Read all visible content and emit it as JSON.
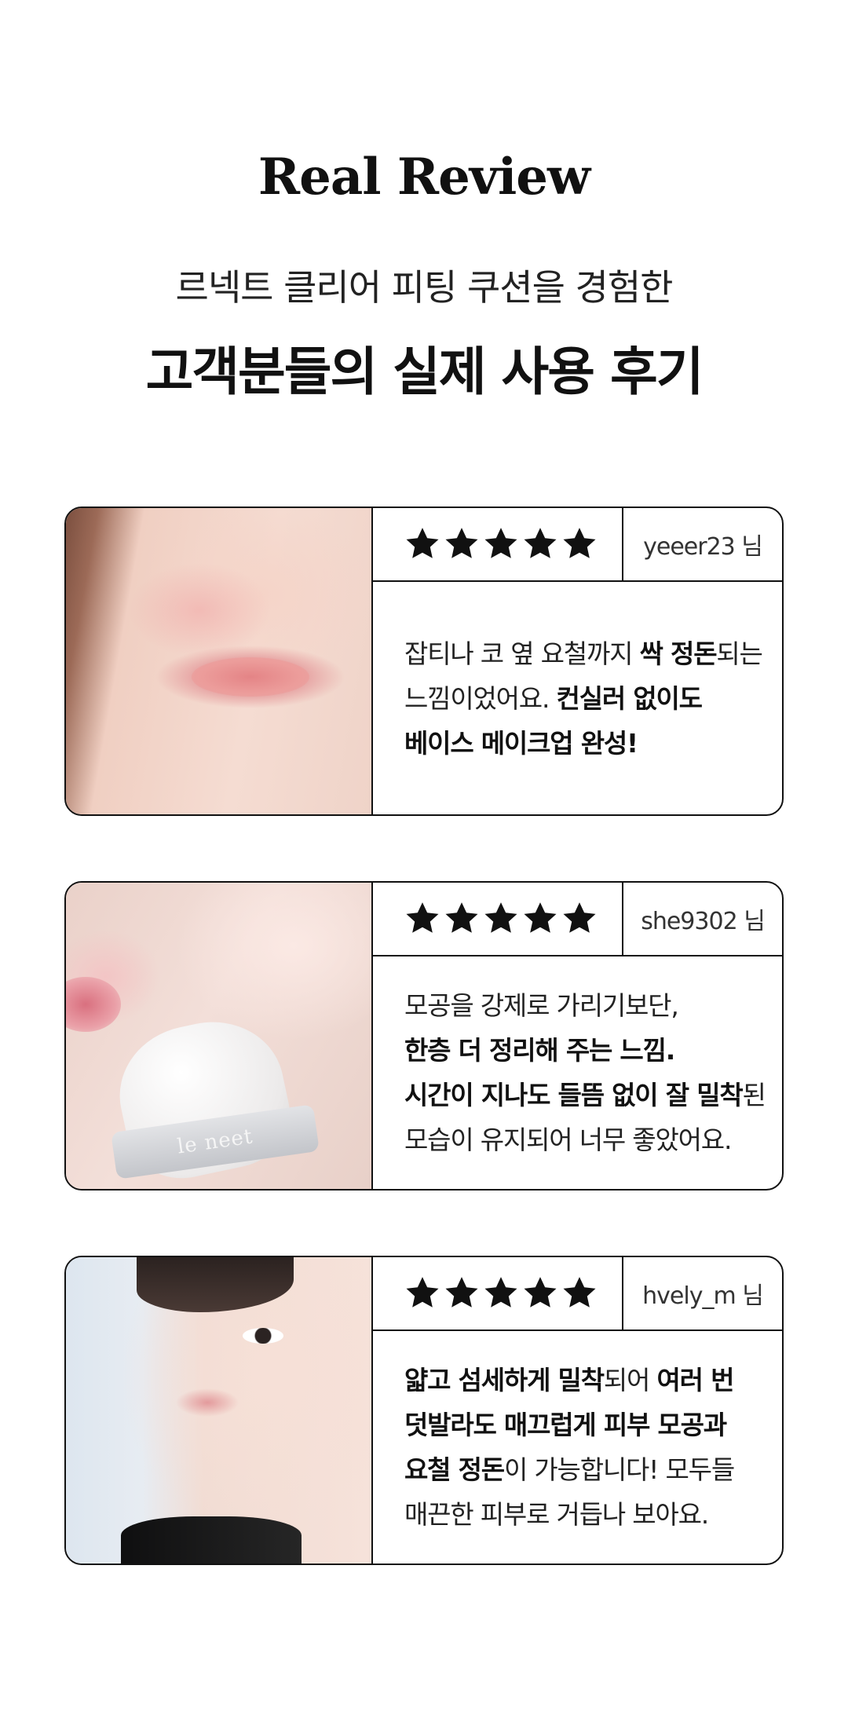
{
  "header": {
    "title": "Real Review",
    "subtitle_line1": "르넥트 클리어 피팅 쿠션을 경험한",
    "subtitle_line2": "고객분들의 실제 사용 후기"
  },
  "reviews": [
    {
      "rating": 5,
      "user": "yeeer23 님",
      "photo": "face-lips-closeup",
      "lines": [
        [
          {
            "t": "잡티나 코 옆 요철까지 ",
            "b": false
          },
          {
            "t": "싹 정돈",
            "b": true
          },
          {
            "t": "되는",
            "b": false
          }
        ],
        [
          {
            "t": "느낌이었어요. ",
            "b": false
          },
          {
            "t": "컨실러 없이도",
            "b": true
          }
        ],
        [
          {
            "t": "베이스 메이크업 완성!",
            "b": true
          }
        ]
      ]
    },
    {
      "rating": 5,
      "user": "she9302 님",
      "photo": "cheek-with-puff",
      "band_text": "le neet",
      "lines": [
        [
          {
            "t": "모공을 강제로 가리기보단,",
            "b": false
          }
        ],
        [
          {
            "t": "한층 더 정리해 주는 느낌.",
            "b": true
          }
        ],
        [
          {
            "t": "시간이 지나도 들뜸 없이 잘 밀착",
            "b": true
          },
          {
            "t": "된",
            "b": false
          }
        ],
        [
          {
            "t": "모습이 유지되어 너무 좋았어요.",
            "b": false
          }
        ]
      ]
    },
    {
      "rating": 5,
      "user": "hvely_m 님",
      "photo": "half-face-portrait",
      "lines": [
        [
          {
            "t": "얇고 섬세하게 밀착",
            "b": true
          },
          {
            "t": "되어 ",
            "b": false
          },
          {
            "t": "여러 번",
            "b": true
          }
        ],
        [
          {
            "t": "덧발라도 매끄럽게 피부 모공과",
            "b": true
          }
        ],
        [
          {
            "t": "요철 정돈",
            "b": true
          },
          {
            "t": "이 가능합니다! 모두들",
            "b": false
          }
        ],
        [
          {
            "t": "매끈한 피부로 거듭나 보아요.",
            "b": false
          }
        ]
      ]
    }
  ],
  "icons": {
    "star": "star-icon",
    "star_color": "#111111"
  }
}
